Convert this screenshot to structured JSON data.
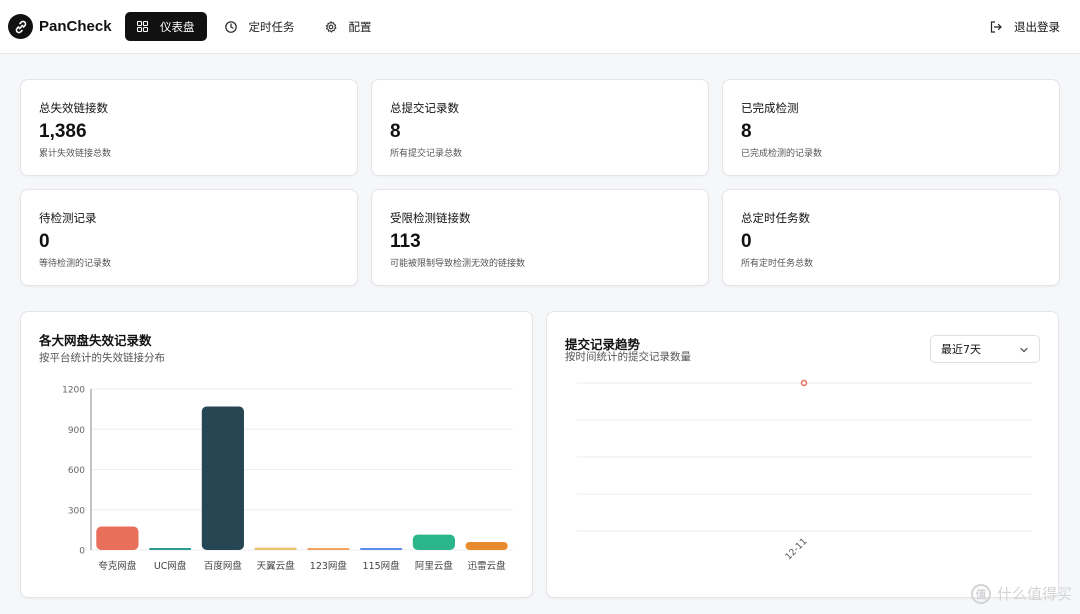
{
  "app": {
    "name": "PanCheck"
  },
  "nav": [
    {
      "label": "仪表盘",
      "icon": "dashboard-icon",
      "active": true
    },
    {
      "label": "定时任务",
      "icon": "clock-icon",
      "active": false
    },
    {
      "label": "配置",
      "icon": "gear-icon",
      "active": false
    }
  ],
  "logout": {
    "label": "退出登录",
    "icon": "logout-icon"
  },
  "stats": [
    {
      "title": "总失效链接数",
      "value": "1,386",
      "sub": "累计失效链接总数"
    },
    {
      "title": "总提交记录数",
      "value": "8",
      "sub": "所有提交记录总数"
    },
    {
      "title": "已完成检测",
      "value": "8",
      "sub": "已完成检测的记录数"
    },
    {
      "title": "待检测记录",
      "value": "0",
      "sub": "等待检测的记录数"
    },
    {
      "title": "受限检测链接数",
      "value": "113",
      "sub": "可能被限制导致检测无效的链接数"
    },
    {
      "title": "总定时任务数",
      "value": "0",
      "sub": "所有定时任务总数"
    }
  ],
  "bar_panel": {
    "title": "各大网盘失效记录数",
    "subtitle": "按平台统计的失效链接分布"
  },
  "trend_panel": {
    "title": "提交记录趋势",
    "subtitle": "按时间统计的提交记录数量",
    "range_select": "最近7天"
  },
  "colors": {
    "quark": "#e8705a",
    "uc": "#2a9d8f",
    "baidu": "#264653",
    "tianyi": "#e9c46a",
    "c123": "#f4a261",
    "c115": "#5b8def",
    "aliyun": "#2bb58a",
    "xunlei": "#e98a2e",
    "trend_point": "#e8705a"
  },
  "watermark": {
    "text": "什么值得买",
    "mark": "值"
  },
  "chart_data": [
    {
      "type": "bar",
      "categories": [
        "夸克网盘",
        "UC网盘",
        "百度网盘",
        "天翼云盘",
        "123网盘",
        "115网盘",
        "阿里云盘",
        "迅雷云盘"
      ],
      "values": [
        175,
        10,
        1070,
        18,
        4,
        8,
        115,
        60
      ],
      "ylim": [
        0,
        1200
      ],
      "yticks": [
        "0",
        "300",
        "600",
        "900",
        "1200"
      ],
      "grid": true
    },
    {
      "type": "line",
      "x": [
        "12-11"
      ],
      "values": [
        8
      ],
      "grid": true
    }
  ]
}
